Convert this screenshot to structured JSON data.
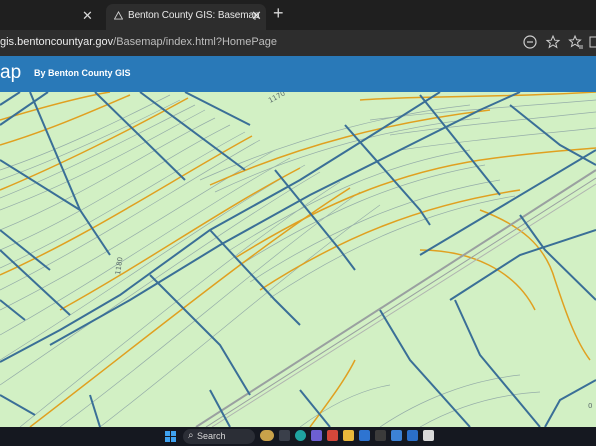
{
  "browser": {
    "prev_tab_close": "✕",
    "active_tab": {
      "title": "Benton County GIS: Basemap",
      "close": "✕"
    },
    "new_tab": "+",
    "url": {
      "host": "gis.bentoncountyar.gov",
      "path": "/Basemap/index.html?HomePage"
    },
    "icons": [
      "minus-circle-icon",
      "star-icon",
      "favorites-icon",
      "more-icon"
    ]
  },
  "app_header": {
    "title_fragment": "ap",
    "byline": "By Benton County GIS",
    "color": "#2979b8"
  },
  "map": {
    "background": "#d2f0c4",
    "contour_color_major": "#e0a020",
    "contour_color_minor": "#8fa6a6",
    "parcel_line_color": "#3a6f97",
    "labels": [
      {
        "text": "1170"
      },
      {
        "text": "1180"
      },
      {
        "text": "0"
      }
    ]
  },
  "taskbar": {
    "search_label": "Search",
    "apps": [
      "start-icon",
      "widgets-icon",
      "task-view-icon",
      "edge-icon",
      "teams-icon",
      "office-icon",
      "explorer-icon",
      "store-icon",
      "files-icon",
      "mail-icon",
      "calendar-icon",
      "settings-icon",
      "terminal-icon"
    ]
  }
}
